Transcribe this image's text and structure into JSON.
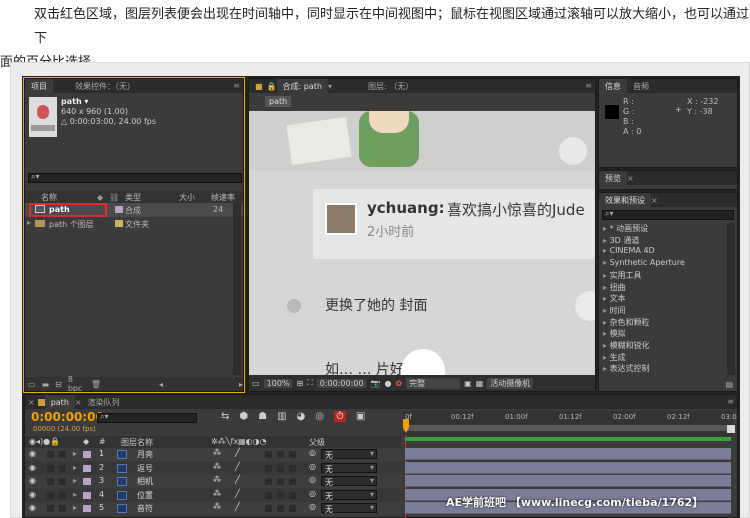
{
  "caption": {
    "line1": "双击红色区域，图层列表便会出现在时间轴中，同时显示在中间视图中；鼠标在视图区域通过滚轴可以放大缩小，也可以通过下",
    "line2": "面的百分比选择"
  },
  "project": {
    "tab_project": "项目",
    "tab_effects": "效果控件：（无）",
    "name": "path ▾",
    "dims": "640 x 960 (1.00)",
    "duration": "△ 0:00:03:00, 24.00 fps",
    "search_placeholder": "",
    "headers": [
      "名称",
      "类型",
      "大小",
      "帧速率"
    ],
    "items": [
      {
        "name": "path",
        "type": "合成",
        "size": "",
        "fps": "24"
      },
      {
        "name": "path 个图层",
        "type": "文件夹",
        "size": "",
        "fps": ""
      }
    ],
    "footer_bpc": "8 bpc"
  },
  "viewer": {
    "tab_comp": "合成: path",
    "tab_layer": "图层: （无）",
    "comp_label": "path",
    "post_user": "ychuang:",
    "post_text": "喜欢搞小惊喜的Jude",
    "post_time": "2小时前",
    "post_body": "更换了她的 封面",
    "bottom_text": "如…     … 片好有",
    "zoom": "100%",
    "timecode": "0:00:00:00",
    "quality": "完整",
    "camera": "活动摄像机"
  },
  "info": {
    "tab_info": "信息",
    "tab_audio": "音频",
    "r": "R :",
    "g": "G :",
    "b": "B :",
    "a": "A : 0",
    "x": "X : -232",
    "y": "Y : -38"
  },
  "preview": {
    "tab": "预览"
  },
  "effects": {
    "tab": "效果和预设",
    "items": [
      "* 动画预设",
      "3D 通道",
      "CINEMA 4D",
      "Synthetic Aperture",
      "实用工具",
      "扭曲",
      "文本",
      "时间",
      "杂色和颗粒",
      "模拟",
      "模糊和锐化",
      "生成",
      "表达式控制"
    ]
  },
  "timeline": {
    "tab_path": "path",
    "tab_render": "渲染队列",
    "timecode": "0:00:00:00",
    "fps": "00000 (24.00 fps)",
    "ruler": [
      "0f",
      "00:12f",
      "01:00f",
      "01:12f",
      "02:00f",
      "02:12f",
      "03:0"
    ],
    "col_num": "#",
    "col_name": "图层名称",
    "col_parent": "父级",
    "layers": [
      {
        "num": "1",
        "name": "月亮",
        "parent": "无"
      },
      {
        "num": "2",
        "name": "返号",
        "parent": "无"
      },
      {
        "num": "3",
        "name": "相机",
        "parent": "无"
      },
      {
        "num": "4",
        "name": "位置",
        "parent": "无"
      },
      {
        "num": "5",
        "name": "音符",
        "parent": "无"
      }
    ]
  },
  "watermark": "AE学前班吧 【www.linecg.com/tieba/1762】",
  "colors": {
    "accent": "#e3b300",
    "red_box": "#e0282e",
    "layer_bar": "#7c7c99",
    "green_bar": "#37a33a",
    "orange": "#f7a000"
  }
}
